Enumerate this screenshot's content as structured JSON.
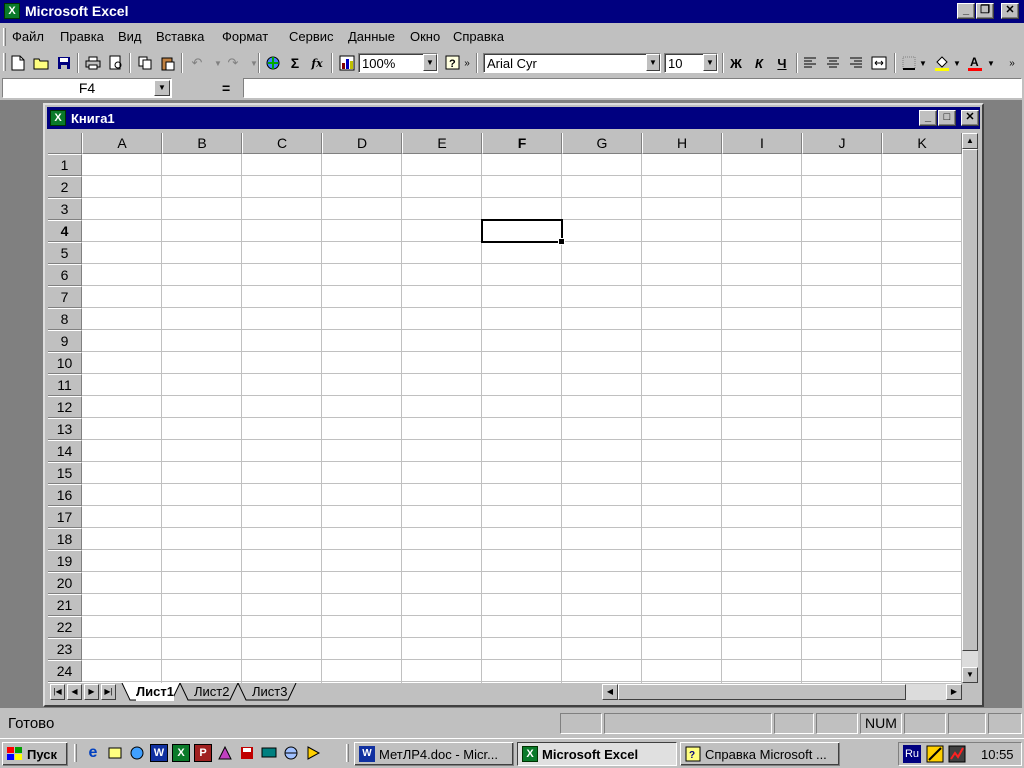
{
  "app": {
    "title": "Microsoft Excel",
    "controls": {
      "minimize": "_",
      "restore": "❐",
      "close": "✕"
    }
  },
  "menu": [
    "Файл",
    "Правка",
    "Вид",
    "Вставка",
    "Формат",
    "Сервис",
    "Данные",
    "Окно",
    "Справка"
  ],
  "toolbar": {
    "zoom": "100%",
    "font": "Arial Cyr",
    "size": "10",
    "bold": "Ж",
    "italic": "К",
    "underline": "Ч",
    "sum": "Σ",
    "fx": "fx",
    "more": "»"
  },
  "formula_bar": {
    "cell_ref": "F4",
    "equals": "=",
    "value": ""
  },
  "workbook": {
    "title": "Книга1",
    "columns": [
      "A",
      "B",
      "C",
      "D",
      "E",
      "F",
      "G",
      "H",
      "I",
      "J",
      "K"
    ],
    "rows": [
      "1",
      "2",
      "3",
      "4",
      "5",
      "6",
      "7",
      "8",
      "9",
      "10",
      "11",
      "12",
      "13",
      "14",
      "15",
      "16",
      "17",
      "18",
      "19",
      "20",
      "21",
      "22",
      "23",
      "24"
    ],
    "active_col": "F",
    "active_row": "4",
    "sheets": [
      "Лист1",
      "Лист2",
      "Лист3"
    ],
    "active_sheet": "Лист1"
  },
  "status": {
    "text": "Готово",
    "num": "NUM"
  },
  "taskbar": {
    "start": "Пуск",
    "tasks": [
      {
        "label": "МетЛР4.doc - Micr...",
        "active": false
      },
      {
        "label": "Microsoft Excel",
        "active": true
      },
      {
        "label": "Справка Microsoft ...",
        "active": false
      }
    ],
    "lang": "Ru",
    "clock": "10:55"
  },
  "colors": {
    "titlebar": "#000080",
    "face": "#c0c0c0",
    "workspace": "#808080"
  }
}
